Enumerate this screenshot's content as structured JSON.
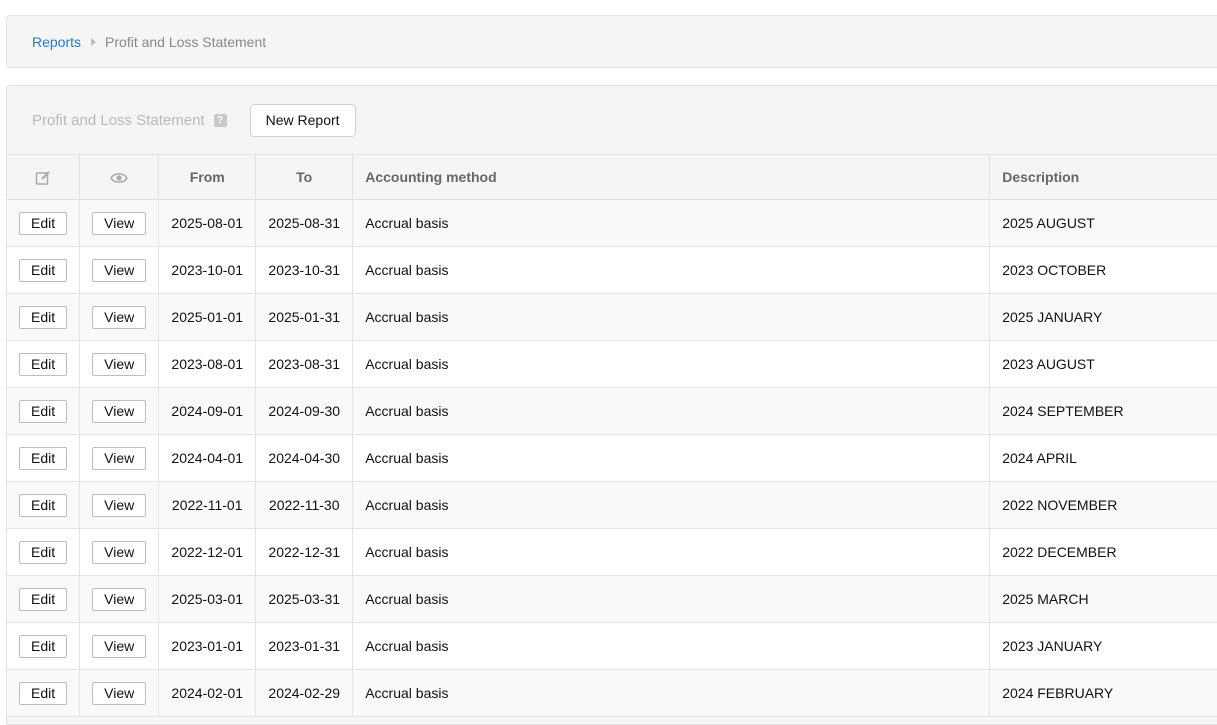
{
  "breadcrumb": {
    "link": "Reports",
    "current": "Profit and Loss Statement"
  },
  "panel": {
    "title": "Profit and Loss Statement",
    "help_icon": "?",
    "new_report_label": "New Report"
  },
  "table": {
    "columns": {
      "edit_icon": "edit-icon",
      "view_icon": "eye-icon",
      "from": "From",
      "to": "To",
      "method": "Accounting method",
      "description": "Description"
    },
    "edit_label": "Edit",
    "view_label": "View",
    "rows": [
      {
        "from": "2025-08-01",
        "to": "2025-08-31",
        "method": "Accrual basis",
        "description": "2025 AUGUST"
      },
      {
        "from": "2023-10-01",
        "to": "2023-10-31",
        "method": "Accrual basis",
        "description": "2023 OCTOBER"
      },
      {
        "from": "2025-01-01",
        "to": "2025-01-31",
        "method": "Accrual basis",
        "description": "2025 JANUARY"
      },
      {
        "from": "2023-08-01",
        "to": "2023-08-31",
        "method": "Accrual basis",
        "description": "2023 AUGUST"
      },
      {
        "from": "2024-09-01",
        "to": "2024-09-30",
        "method": "Accrual basis",
        "description": "2024 SEPTEMBER"
      },
      {
        "from": "2024-04-01",
        "to": "2024-04-30",
        "method": "Accrual basis",
        "description": "2024 APRIL"
      },
      {
        "from": "2022-11-01",
        "to": "2022-11-30",
        "method": "Accrual basis",
        "description": "2022 NOVEMBER"
      },
      {
        "from": "2022-12-01",
        "to": "2022-12-31",
        "method": "Accrual basis",
        "description": "2022 DECEMBER"
      },
      {
        "from": "2025-03-01",
        "to": "2025-03-31",
        "method": "Accrual basis",
        "description": "2025 MARCH"
      },
      {
        "from": "2023-01-01",
        "to": "2023-01-31",
        "method": "Accrual basis",
        "description": "2023 JANUARY"
      },
      {
        "from": "2024-02-01",
        "to": "2024-02-29",
        "method": "Accrual basis",
        "description": "2024 FEBRUARY"
      }
    ]
  },
  "colors": {
    "link": "#2a7ab8",
    "muted": "#888888",
    "panel_bg": "#f5f5f5"
  }
}
